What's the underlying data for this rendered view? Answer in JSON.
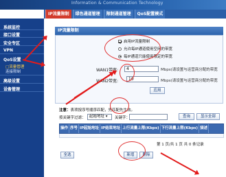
{
  "header": {
    "text": "Information & Communication Technology"
  },
  "tabs": [
    {
      "label": "IP流量限制",
      "active": true
    },
    {
      "label": "绿色通道管理",
      "active": false
    },
    {
      "label": "限制通道管理",
      "active": false
    },
    {
      "label": "QoS配置模式",
      "active": false
    }
  ],
  "sidebar": {
    "items": [
      {
        "label": "系统监控"
      },
      {
        "label": "接口设置"
      },
      {
        "label": "安全专区"
      },
      {
        "label": "VPN"
      },
      {
        "label": "QoS设置"
      },
      {
        "label": "高级设置"
      },
      {
        "label": "设备管理"
      }
    ],
    "subitems": [
      {
        "label": "□流量管理",
        "active": true
      },
      {
        "label": "连接限制",
        "active": false
      }
    ]
  },
  "panel": {
    "title": "IP流量限制",
    "enable_label": "启用IP流量限制",
    "radio_1_label": "允许每IP通道使用空闲的带宽",
    "radio_2_label": "每IP通道只能使用限定的带宽",
    "wan1_label": "WAN1带宽:",
    "wan1_value": "4",
    "wan1_desc": "Mbps(请设置与运营商分配的带宽",
    "wan2_label": "WAN2带宽:",
    "wan2_value": "10",
    "wan2_desc": "Mbps(请设置与运营商分配的带宽",
    "apply_label": "应用"
  },
  "list": {
    "note_bold": "注意：",
    "note_text": "表项按序号顺序匹配，先匹配先生效。",
    "filter_label": "按关键字过滤：",
    "filter_select": "起始地址",
    "keyword_label": "关键字：",
    "query_label": "查询",
    "show_all_label": "显示全部",
    "columns": [
      "操作",
      "序号",
      "IP起始地址",
      "IP结束地址",
      "上行流量上限(Kbps)",
      "下行流量上限(Kbps)",
      "描述"
    ],
    "pager_text": "第 1 页/共 1 页 共 0 条记录"
  },
  "actions": {
    "select_all_label": "全选",
    "new_label": "新增",
    "delete_label": "删除"
  },
  "colors": {
    "accent": "#e21b1b",
    "tab_active": "#d23c2c",
    "sidebar": "#16408a"
  }
}
